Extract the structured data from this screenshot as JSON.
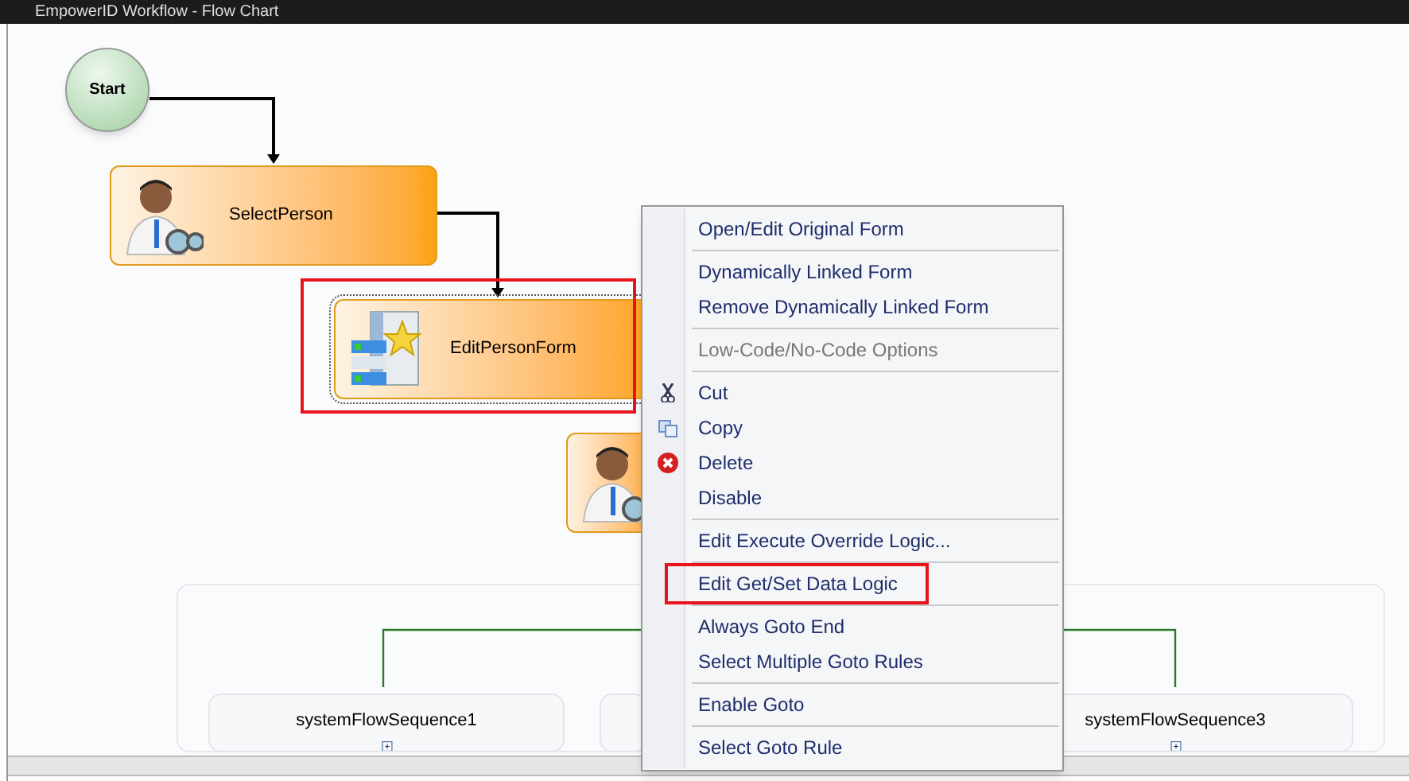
{
  "window": {
    "title": "EmpowerID Workflow - Flow Chart"
  },
  "nodes": [
    {
      "kind": "start",
      "label": "Start",
      "selected": false,
      "annotated": false
    },
    {
      "kind": "person",
      "label": "SelectPerson",
      "selected": false,
      "annotated": false
    },
    {
      "kind": "form",
      "label": "EditPersonForm",
      "selected": true,
      "annotated": true
    },
    {
      "kind": "person",
      "selected": false,
      "annotated": false
    }
  ],
  "sequences": [
    {
      "label": "systemFlowSequence1"
    },
    {
      "label": "systemFlowSequence3"
    }
  ],
  "context_menu": {
    "groups": [
      [
        {
          "kind": "plain",
          "label": "Open/Edit Original Form",
          "disabled": false,
          "annotated": false
        }
      ],
      [
        {
          "kind": "plain",
          "label": "Dynamically Linked Form",
          "disabled": false,
          "annotated": false
        },
        {
          "kind": "plain",
          "label": "Remove Dynamically Linked Form",
          "disabled": false,
          "annotated": false
        }
      ],
      [
        {
          "kind": "plain",
          "label": "Low-Code/No-Code Options",
          "disabled": true,
          "annotated": false
        }
      ],
      [
        {
          "kind": "cut",
          "label": "Cut",
          "disabled": false,
          "annotated": false
        },
        {
          "kind": "copy",
          "label": "Copy",
          "disabled": false,
          "annotated": false
        },
        {
          "kind": "delete",
          "label": "Delete",
          "disabled": false,
          "annotated": false
        },
        {
          "kind": "plain",
          "label": "Disable",
          "disabled": false,
          "annotated": false
        }
      ],
      [
        {
          "kind": "plain",
          "label": "Edit Execute Override Logic...",
          "disabled": false,
          "annotated": false
        }
      ],
      [
        {
          "kind": "plain",
          "label": "Edit Get/Set Data Logic",
          "disabled": false,
          "annotated": true
        }
      ],
      [
        {
          "kind": "plain",
          "label": "Always Goto End",
          "disabled": false,
          "annotated": false
        },
        {
          "kind": "plain",
          "label": "Select Multiple Goto Rules",
          "disabled": false,
          "annotated": false
        }
      ],
      [
        {
          "kind": "plain",
          "label": "Enable Goto",
          "disabled": false,
          "annotated": false
        }
      ],
      [
        {
          "kind": "plain",
          "label": "Select Goto Rule",
          "disabled": false,
          "annotated": false
        }
      ]
    ]
  }
}
